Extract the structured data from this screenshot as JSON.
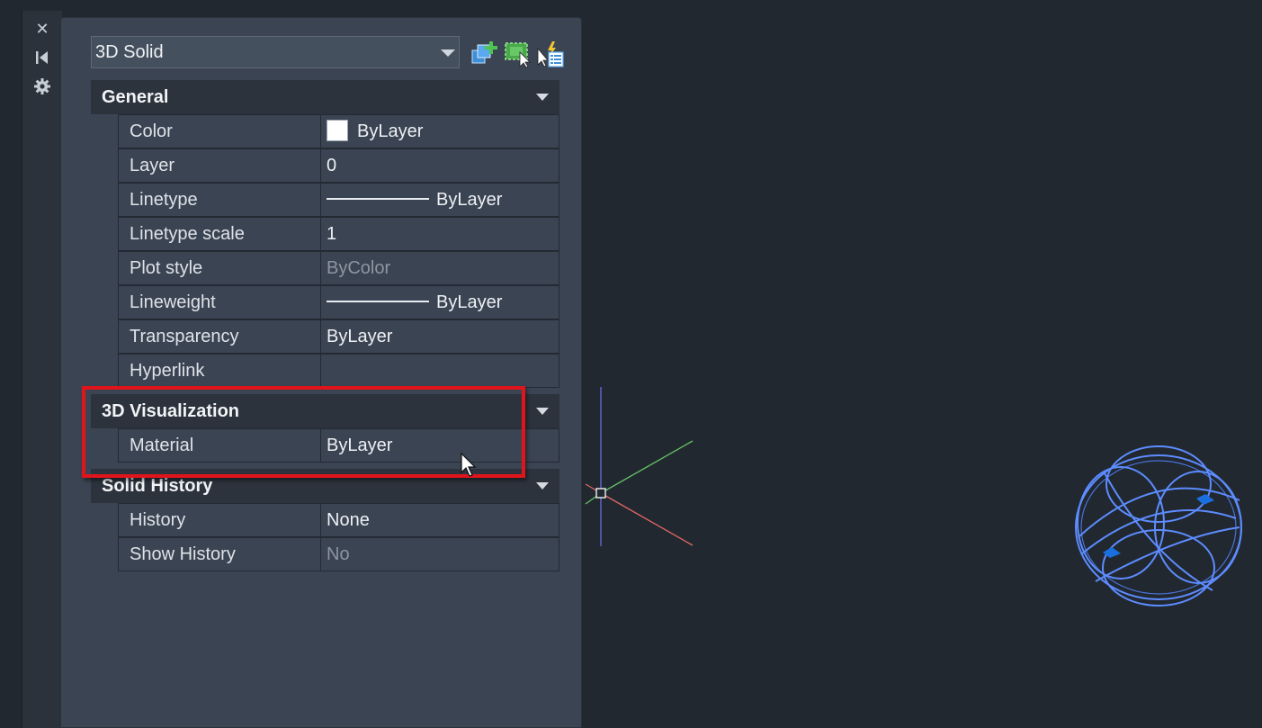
{
  "window": {
    "close_glyph": "✕",
    "icons": {
      "close": "close-icon",
      "auto_hide": "auto-hide-icon",
      "settings": "gear-icon"
    }
  },
  "toolbar": {
    "object_type": "3D Solid",
    "buttons": [
      "toggle-pickadd-icon",
      "select-objects-icon",
      "quick-select-icon"
    ]
  },
  "sections": {
    "general": {
      "title": "General",
      "rows": {
        "color": {
          "label": "Color",
          "value": "ByLayer",
          "swatch": "#ffffff"
        },
        "layer": {
          "label": "Layer",
          "value": "0"
        },
        "linetype": {
          "label": "Linetype",
          "value": "ByLayer"
        },
        "linetype_scale": {
          "label": "Linetype scale",
          "value": "1"
        },
        "plot_style": {
          "label": "Plot style",
          "value": "ByColor"
        },
        "lineweight": {
          "label": "Lineweight",
          "value": "ByLayer"
        },
        "transparency": {
          "label": "Transparency",
          "value": "ByLayer"
        },
        "hyperlink": {
          "label": "Hyperlink",
          "value": ""
        }
      }
    },
    "visualization": {
      "title": "3D Visualization",
      "rows": {
        "material": {
          "label": "Material",
          "value": "ByLayer"
        }
      }
    },
    "solid_history": {
      "title": "Solid History",
      "rows": {
        "history": {
          "label": "History",
          "value": "None"
        },
        "show_history": {
          "label": "Show History",
          "value": "No"
        }
      }
    }
  },
  "colors": {
    "canvas": "#212830",
    "palette": "#3b4453",
    "highlight": "#e0151b",
    "solid_wire": "#5d8cff",
    "grip": "#1a6fe0",
    "axis_x": "#e06666",
    "axis_y": "#66c266",
    "axis_z": "#6a6adf"
  }
}
